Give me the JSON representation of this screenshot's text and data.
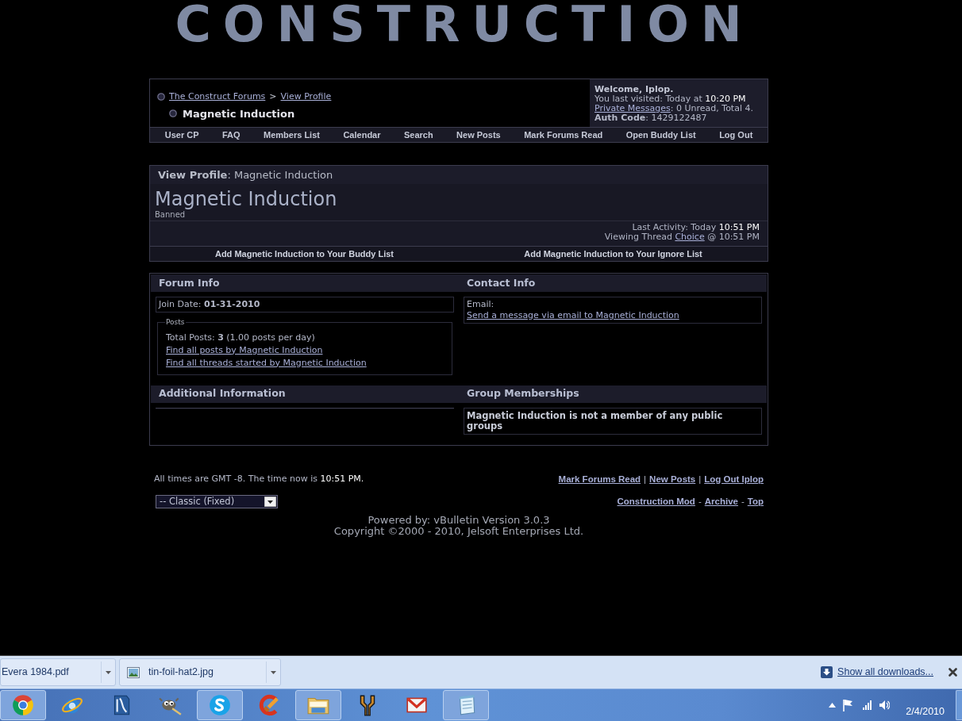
{
  "logo": {
    "text": "CONSTRUCTION"
  },
  "navbar": {
    "breadcrumb": [
      {
        "label": "The Construct Forums"
      },
      {
        "label": "View Profile"
      }
    ],
    "separator": ">",
    "current_page": "Magnetic Induction",
    "welcome": {
      "greeting": "Welcome, Iplop.",
      "last_visited": "You last visited: Today at",
      "last_visited_time": "10:20 PM",
      "messages_link": "Private Messages",
      "messages_status": ": 0 Unread, Total 4.",
      "auth_code": "**Auth Code**: 1429122487"
    },
    "menu": [
      {
        "label": "User CP"
      },
      {
        "label": "FAQ"
      },
      {
        "label": "Members List"
      },
      {
        "label": "Calendar"
      },
      {
        "label": "Search"
      },
      {
        "label": "New Posts"
      },
      {
        "label": "Mark Forums Read"
      },
      {
        "label": "Open Buddy List"
      },
      {
        "label": "Log Out"
      }
    ]
  },
  "profile": {
    "heading": "**View Profile**: Magnetic Induction",
    "username": "Magnetic Induction",
    "user_title": "Banned",
    "last_activity": "Last Activity: Today",
    "last_activity_time": "10:51 PM",
    "viewing_prefix": "Viewing Thread",
    "viewing_thread": "Choice",
    "viewing_time": "@ 10:51 PM",
    "actions": [
      {
        "label": "Add Magnetic Induction to Your Buddy List"
      },
      {
        "label": "Add Magnetic Induction to Your Ignore List"
      }
    ]
  },
  "forum_info": {
    "title": "Forum Info",
    "join_date": "Join Date: **01-31-2010**",
    "posts": {
      "legend": "Posts",
      "total": "Total Posts: **3** (1.00 posts per day)",
      "links": [
        {
          "label": "Find all posts by Magnetic Induction"
        },
        {
          "label": "Find all threads started by Magnetic Induction"
        }
      ]
    }
  },
  "contact_info": {
    "title": "Contact Info",
    "email_label": "Email:",
    "email_link": "Send a message via email to Magnetic Induction"
  },
  "additional_information": {
    "title": "Additional Information"
  },
  "group_memberships": {
    "title": "Group Memberships",
    "message": "Magnetic Induction is not a member of any public groups"
  },
  "footer": {
    "timezone": "All times are GMT -8. The time now is",
    "time_now": "10:51 PM.",
    "links": [
      {
        "kind": "link",
        "label": "Mark Forums Read"
      },
      {
        "kind": "separator",
        "label": "|"
      },
      {
        "kind": "link",
        "label": "New Posts"
      },
      {
        "kind": "separator",
        "label": "|"
      },
      {
        "kind": "link",
        "label": "Log Out Iplop"
      }
    ],
    "style_select": {
      "value": "-- Classic (Fixed)"
    },
    "secondary_links": [
      {
        "kind": "link",
        "label": "Construction Mod"
      },
      {
        "kind": "separator",
        "label": "-"
      },
      {
        "kind": "link",
        "label": "Archive"
      },
      {
        "kind": "separator",
        "label": "-"
      },
      {
        "kind": "link",
        "label": "Top"
      }
    ],
    "powered_by": "Powered by: vBulletin Version 3.0.3",
    "copyright": "Copyright ©2000 - 2010, Jelsoft Enterprises Ltd."
  },
  "downloads_bar": {
    "items": [
      {
        "name": "Evera 1984.pdf",
        "kind": "pdf"
      },
      {
        "name": "tin-foil-hat2.jpg",
        "kind": "image"
      }
    ],
    "show_all": "Show all downloads..."
  },
  "taskbar": {
    "items": [
      {
        "kind": "browser",
        "active": true
      },
      {
        "kind": "explorer",
        "active": false
      },
      {
        "kind": "office",
        "active": false
      },
      {
        "kind": "image-editor",
        "active": false
      },
      {
        "kind": "chat",
        "active": true
      },
      {
        "kind": "cleaner",
        "active": false
      },
      {
        "kind": "folder",
        "active": true
      },
      {
        "kind": "tool",
        "active": false
      },
      {
        "kind": "mail",
        "active": false
      },
      {
        "kind": "notes",
        "active": true
      }
    ],
    "date": "2/4/2010"
  }
}
